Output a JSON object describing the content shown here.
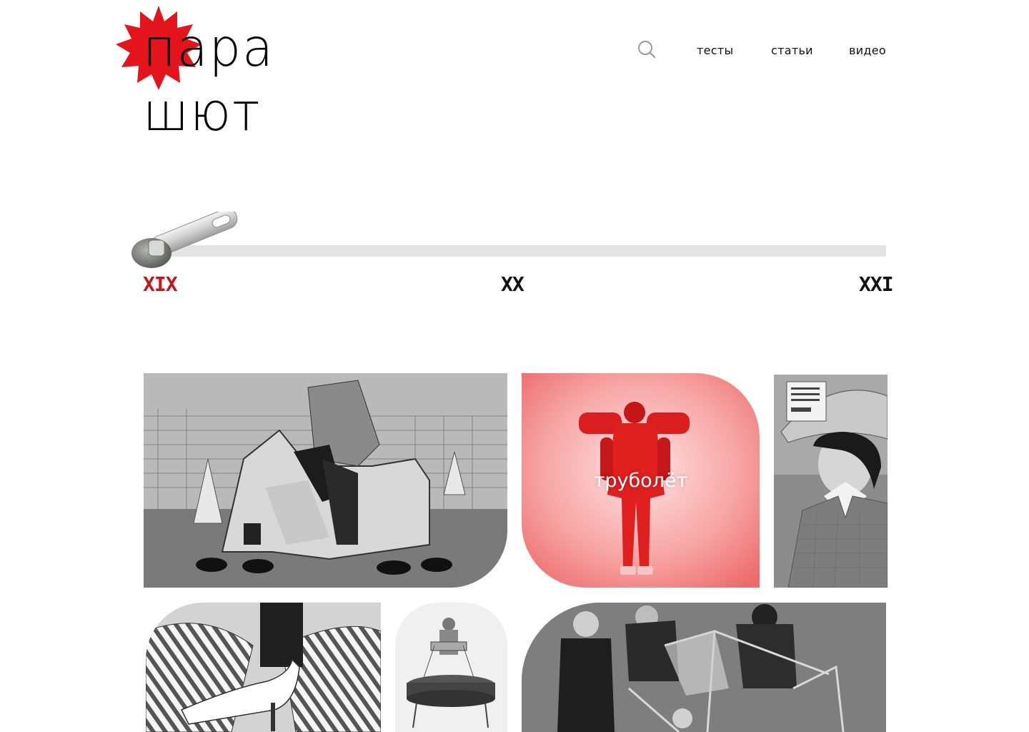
{
  "brand": {
    "line1": "пара",
    "line2": "шют",
    "accent_color": "#e3141b"
  },
  "nav": {
    "search_icon": "search-icon",
    "items": [
      {
        "label": "тесты"
      },
      {
        "label": "статьи"
      },
      {
        "label": "видео"
      }
    ]
  },
  "timeline": {
    "centuries": [
      {
        "label": "XIX",
        "active": true
      },
      {
        "label": "XX",
        "active": false
      },
      {
        "label": "XXI",
        "active": false
      }
    ],
    "active_color": "#c8141b",
    "position": 0
  },
  "cards": [
    {
      "id": "scooter",
      "label": ""
    },
    {
      "id": "jetpack",
      "label": "труболёт"
    },
    {
      "id": "helmet",
      "label": ""
    },
    {
      "id": "umbrella",
      "label": ""
    },
    {
      "id": "platform",
      "label": ""
    },
    {
      "id": "tallbike",
      "label": ""
    }
  ]
}
